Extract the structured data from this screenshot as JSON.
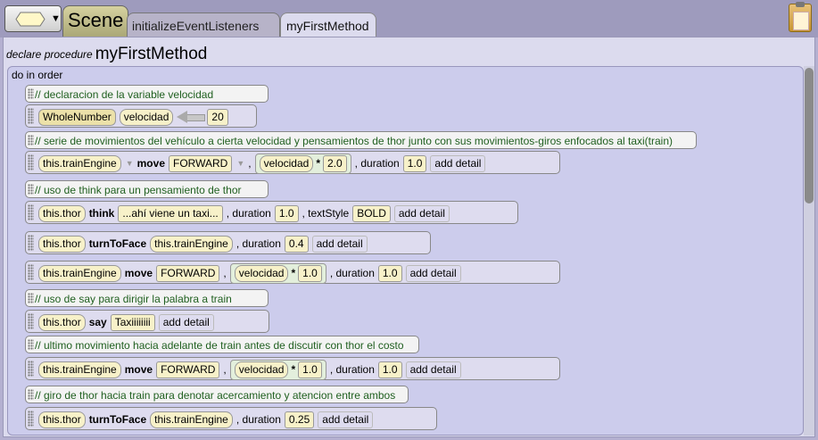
{
  "tabs": {
    "scene": "Scene",
    "init": "initializeEventListeners",
    "current": "myFirstMethod"
  },
  "declare": {
    "keyword": "declare procedure",
    "name": "myFirstMethod"
  },
  "body": {
    "do_in_order": "do in order",
    "add_detail": "add detail"
  },
  "lines": {
    "c1": "// declaracion de la variable velocidad",
    "v_type": "WholeNumber",
    "v_name": "velocidad",
    "v_value": "20",
    "c2": "// serie de movimientos del vehículo a cierta velocidad y pensamientos de thor junto con sus movimientos-giros enfocados al taxi(train)",
    "s1_obj": "this.trainEngine",
    "s1_method": "move",
    "s1_dir": "FORWARD",
    "s1_var": "velocidad",
    "s1_op": "*",
    "s1_factor": "2.0",
    "s1_dur_label": ", duration",
    "s1_dur": "1.0",
    "c3": "// uso de think para un pensamiento de thor",
    "s2_obj": "this.thor",
    "s2_method": "think",
    "s2_text": "...ahí viene un taxi...",
    "s2_dur_label": ", duration",
    "s2_dur": "1.0",
    "s2_style_label": ", textStyle",
    "s2_style": "BOLD",
    "s3_obj": "this.thor",
    "s3_method": "turnToFace",
    "s3_target": "this.trainEngine",
    "s3_dur_label": ", duration",
    "s3_dur": "0.4",
    "s4_obj": "this.trainEngine",
    "s4_method": "move",
    "s4_dir": "FORWARD",
    "s4_var": "velocidad",
    "s4_op": "*",
    "s4_factor": "1.0",
    "s4_dur_label": ", duration",
    "s4_dur": "1.0",
    "c4": "// uso de say para dirigir la palabra a train",
    "s5_obj": "this.thor",
    "s5_method": "say",
    "s5_text": "Taxiiiiiiii",
    "c5": "// ultimo movimiento hacia adelante de train antes de discutir con thor el costo",
    "s6_obj": "this.trainEngine",
    "s6_method": "move",
    "s6_dir": "FORWARD",
    "s6_var": "velocidad",
    "s6_op": "*",
    "s6_factor": "1.0",
    "s6_dur_label": ", duration",
    "s6_dur": "1.0",
    "c6": "// giro de thor hacia train para denotar acercamiento y atencion entre ambos",
    "s7_obj": "this.thor",
    "s7_method": "turnToFace",
    "s7_target": "this.trainEngine",
    "s7_dur_label": ", duration",
    "s7_dur": "0.25"
  },
  "icons": {
    "type_menu": "hexagon-dropdown-icon",
    "clipboard": "clipboard-icon",
    "assign": "left-arrow-icon"
  },
  "colors": {
    "comment_text": "#1f5f1f",
    "panel_bg": "#dcdbee",
    "body_bg": "#ccccec",
    "scene_tab": "#c8c594"
  }
}
